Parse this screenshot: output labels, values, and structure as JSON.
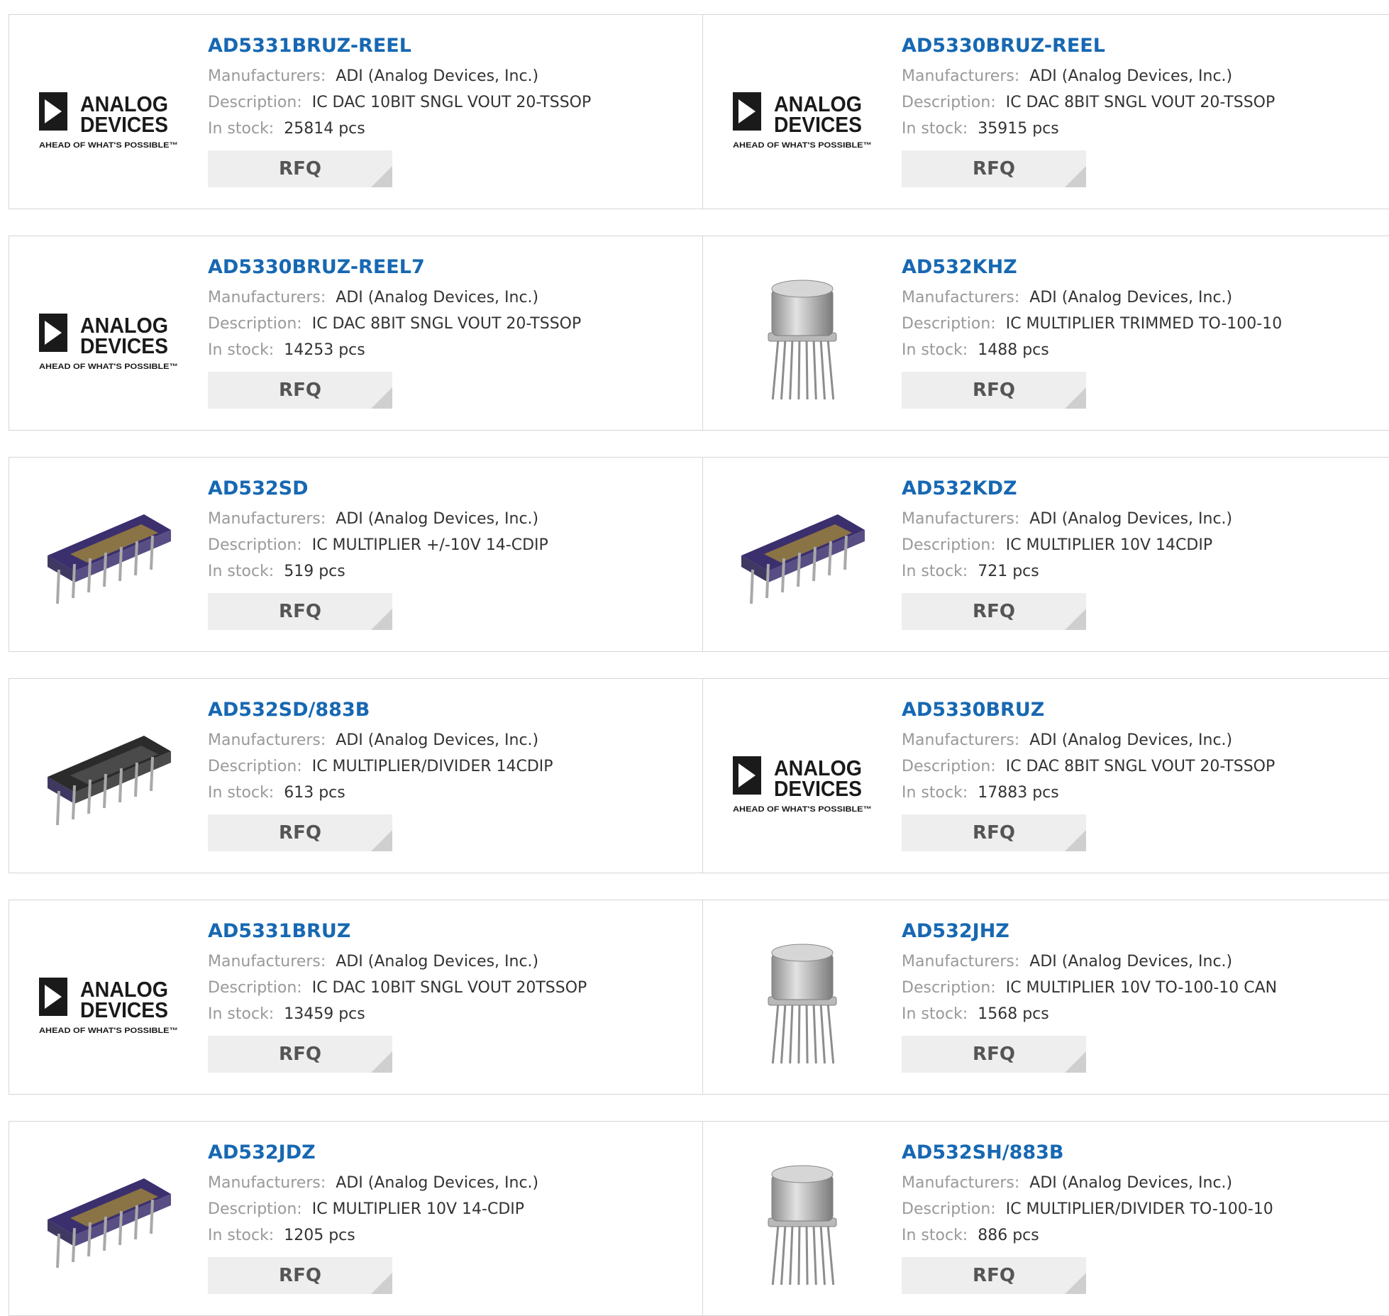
{
  "labels": {
    "manufacturer": "Manufacturers:",
    "description": "Description:",
    "stock": "In stock:"
  },
  "brand": {
    "line1": "ANALOG",
    "line2": "DEVICES",
    "tagline": "AHEAD OF WHAT'S POSSIBLE™"
  },
  "colors": {
    "part_link": "#1768b2",
    "label_gray": "#999999",
    "rfq_bg": "#eeeeee",
    "dip_violet": "#3b2f6e",
    "dip_lid_gold": "#8a7345",
    "dip_black": "#2b2b2b",
    "can_silver": "#b9b9b9"
  },
  "products": [
    {
      "part": "AD5331BRUZ-REEL",
      "manufacturer": "ADI (Analog Devices, Inc.)",
      "description": "IC DAC 10BIT SNGL VOUT 20-TSSOP",
      "stock": "25814 pcs",
      "rfq": "RFQ",
      "image": "adi-logo"
    },
    {
      "part": "AD5330BRUZ-REEL",
      "manufacturer": "ADI (Analog Devices, Inc.)",
      "description": "IC DAC 8BIT SNGL VOUT 20-TSSOP",
      "stock": "35915 pcs",
      "rfq": "RFQ",
      "image": "adi-logo"
    },
    {
      "part": "AD5330BRUZ-REEL7",
      "manufacturer": "ADI (Analog Devices, Inc.)",
      "description": "IC DAC 8BIT SNGL VOUT 20-TSSOP",
      "stock": "14253 pcs",
      "rfq": "RFQ",
      "image": "adi-logo"
    },
    {
      "part": "AD532KHZ",
      "manufacturer": "ADI (Analog Devices, Inc.)",
      "description": "IC MULTIPLIER TRIMMED TO-100-10",
      "stock": "1488 pcs",
      "rfq": "RFQ",
      "image": "to100-can"
    },
    {
      "part": "AD532SD",
      "manufacturer": "ADI (Analog Devices, Inc.)",
      "description": "IC MULTIPLIER +/-10V 14-CDIP",
      "stock": "519 pcs",
      "rfq": "RFQ",
      "image": "cdip-violet"
    },
    {
      "part": "AD532KDZ",
      "manufacturer": "ADI (Analog Devices, Inc.)",
      "description": "IC MULTIPLIER 10V 14CDIP",
      "stock": "721 pcs",
      "rfq": "RFQ",
      "image": "cdip-violet"
    },
    {
      "part": "AD532SD/883B",
      "manufacturer": "ADI (Analog Devices, Inc.)",
      "description": "IC MULTIPLIER/DIVIDER 14CDIP",
      "stock": "613 pcs",
      "rfq": "RFQ",
      "image": "cdip-black"
    },
    {
      "part": "AD5330BRUZ",
      "manufacturer": "ADI (Analog Devices, Inc.)",
      "description": "IC DAC 8BIT SNGL VOUT 20-TSSOP",
      "stock": "17883 pcs",
      "rfq": "RFQ",
      "image": "adi-logo"
    },
    {
      "part": "AD5331BRUZ",
      "manufacturer": "ADI (Analog Devices, Inc.)",
      "description": "IC DAC 10BIT SNGL VOUT 20TSSOP",
      "stock": "13459 pcs",
      "rfq": "RFQ",
      "image": "adi-logo"
    },
    {
      "part": "AD532JHZ",
      "manufacturer": "ADI (Analog Devices, Inc.)",
      "description": "IC MULTIPLIER 10V TO-100-10 CAN",
      "stock": "1568 pcs",
      "rfq": "RFQ",
      "image": "to100-can"
    },
    {
      "part": "AD532JDZ",
      "manufacturer": "ADI (Analog Devices, Inc.)",
      "description": "IC MULTIPLIER 10V 14-CDIP",
      "stock": "1205 pcs",
      "rfq": "RFQ",
      "image": "cdip-violet"
    },
    {
      "part": "AD532SH/883B",
      "manufacturer": "ADI (Analog Devices, Inc.)",
      "description": "IC MULTIPLIER/DIVIDER TO-100-10",
      "stock": "886 pcs",
      "rfq": "RFQ",
      "image": "to100-can"
    }
  ]
}
